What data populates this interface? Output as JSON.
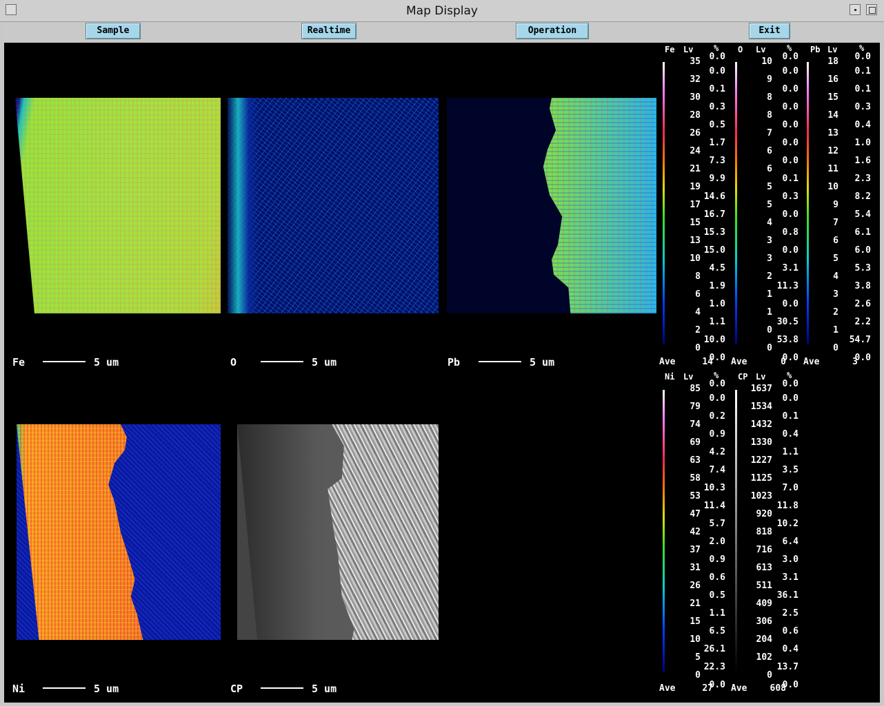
{
  "window": {
    "title": "Map Display"
  },
  "toolbar": {
    "sample": "Sample",
    "realtime": "Realtime",
    "operation": "Operation",
    "exit": "Exit"
  },
  "maps": {
    "fe": {
      "label": "Fe",
      "scale": "5 um"
    },
    "o": {
      "label": "O",
      "scale": "5 um"
    },
    "pb": {
      "label": "Pb",
      "scale": "5 um"
    },
    "ni": {
      "label": "Ni",
      "scale": "5 um"
    },
    "cp": {
      "label": "CP",
      "scale": "5 um"
    }
  },
  "scales": {
    "lv": "Lv",
    "pct": "%",
    "ave": "Ave",
    "fe": {
      "name": "Fe",
      "levels": [
        "35",
        "32",
        "30",
        "28",
        "26",
        "24",
        "21",
        "19",
        "17",
        "15",
        "13",
        "10",
        "8",
        "6",
        "4",
        "2",
        "0"
      ],
      "pct": [
        "0.0",
        "0.0",
        "0.1",
        "0.3",
        "0.5",
        "1.7",
        "7.3",
        "9.9",
        "14.6",
        "16.7",
        "15.3",
        "15.0",
        "4.5",
        "1.9",
        "1.0",
        "1.1",
        "10.0",
        "0.0"
      ],
      "ave": "14"
    },
    "o": {
      "name": "O",
      "levels": [
        "10",
        "9",
        "8",
        "8",
        "7",
        "6",
        "6",
        "5",
        "5",
        "4",
        "3",
        "3",
        "2",
        "1",
        "1",
        "0",
        "0"
      ],
      "pct": [
        "0.0",
        "0.0",
        "0.0",
        "0.0",
        "0.0",
        "0.0",
        "0.0",
        "0.1",
        "0.3",
        "0.0",
        "0.8",
        "0.0",
        "3.1",
        "11.3",
        "0.0",
        "30.5",
        "53.8",
        "0.0"
      ],
      "ave": "0"
    },
    "pb": {
      "name": "Pb",
      "levels": [
        "18",
        "16",
        "15",
        "14",
        "13",
        "12",
        "11",
        "10",
        "9",
        "7",
        "6",
        "5",
        "4",
        "3",
        "2",
        "1",
        "0"
      ],
      "pct": [
        "0.0",
        "0.1",
        "0.1",
        "0.3",
        "0.4",
        "1.0",
        "1.6",
        "2.3",
        "8.2",
        "5.4",
        "6.1",
        "6.0",
        "5.3",
        "3.8",
        "2.6",
        "2.2",
        "54.7",
        "0.0"
      ],
      "ave": "3"
    },
    "ni": {
      "name": "Ni",
      "levels": [
        "85",
        "79",
        "74",
        "69",
        "63",
        "58",
        "53",
        "47",
        "42",
        "37",
        "31",
        "26",
        "21",
        "15",
        "10",
        "5",
        "0"
      ],
      "pct": [
        "0.0",
        "0.0",
        "0.2",
        "0.9",
        "4.2",
        "7.4",
        "10.3",
        "11.4",
        "5.7",
        "2.0",
        "0.9",
        "0.6",
        "0.5",
        "1.1",
        "6.5",
        "26.1",
        "22.3",
        "0.0"
      ],
      "ave": "27"
    },
    "cp": {
      "name": "CP",
      "levels": [
        "1637",
        "1534",
        "1432",
        "1330",
        "1227",
        "1125",
        "1023",
        "920",
        "818",
        "716",
        "613",
        "511",
        "409",
        "306",
        "204",
        "102",
        "0"
      ],
      "pct": [
        "0.0",
        "0.0",
        "0.1",
        "0.4",
        "1.1",
        "3.5",
        "7.0",
        "11.8",
        "10.2",
        "6.4",
        "3.0",
        "3.1",
        "36.1",
        "2.5",
        "0.6",
        "0.4",
        "13.7",
        "0.0"
      ],
      "ave": "608"
    }
  },
  "colors": {
    "display_bg": "#000000",
    "button_bg": "#a6d6ea",
    "frame": "#c8c8c8"
  },
  "icons": {
    "window_menu": "window-menu-icon",
    "minimize": "minimize-icon",
    "maximize": "maximize-icon"
  }
}
